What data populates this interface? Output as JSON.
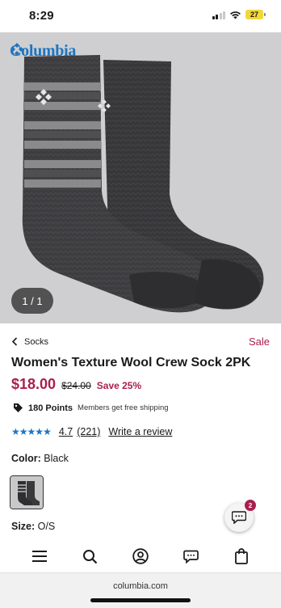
{
  "status": {
    "time": "8:29",
    "battery": "27"
  },
  "brand": {
    "name": "Columbia"
  },
  "gallery": {
    "pager": "1 / 1"
  },
  "product": {
    "breadcrumb": "Socks",
    "sale_tag": "Sale",
    "title": "Women's Texture Wool Crew Sock 2PK",
    "price_now": "$18.00",
    "price_was": "$24.00",
    "price_save": "Save 25%",
    "points": "180 Points",
    "points_note": "Members get free shipping",
    "rating": 4.7,
    "rating_text": "4.7",
    "reviews": "(221)",
    "write_review": "Write a review",
    "color_label": "Color:",
    "color_value": "Black",
    "size_label": "Size:",
    "size_value": "O/S"
  },
  "chat": {
    "badge": "2"
  },
  "nav": {
    "items": [
      "menu-icon",
      "search-icon",
      "account-icon",
      "chat-icon",
      "bag-icon"
    ]
  },
  "browser": {
    "url": "columbia.com"
  },
  "colors": {
    "accent": "#a8204d",
    "brand_blue": "#1e75c0"
  }
}
